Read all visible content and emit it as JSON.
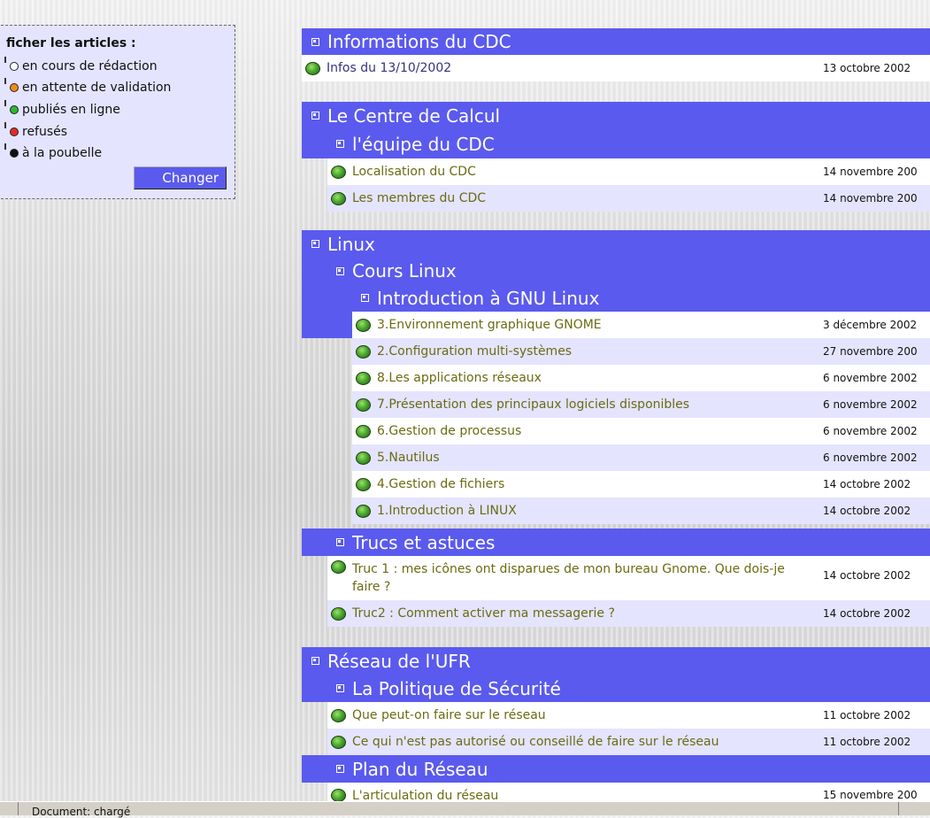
{
  "filter": {
    "title": "ficher les articles :",
    "items": [
      {
        "label": "en cours de rédaction",
        "color": "#ffffff"
      },
      {
        "label": "en attente de validation",
        "color": "#f08a1c"
      },
      {
        "label": "publiés en ligne",
        "color": "#2db82d"
      },
      {
        "label": "refusés",
        "color": "#e22a2a"
      },
      {
        "label": "à la poubelle",
        "color": "#111111"
      }
    ],
    "button": "Changer"
  },
  "sections": {
    "infos": {
      "header": "Informations du CDC",
      "articles": [
        {
          "title": "Infos du 13/10/2002",
          "date": "13 octobre 2002"
        }
      ]
    },
    "cdc": {
      "header": "Le Centre de Calcul",
      "sub": {
        "header": "l'équipe du CDC",
        "articles": [
          {
            "title": "Localisation du CDC",
            "date": "14 novembre 200"
          },
          {
            "title": "Les membres du CDC",
            "date": "14 novembre 200"
          }
        ]
      }
    },
    "linux": {
      "header": "Linux",
      "sub": {
        "header": "Cours Linux",
        "subsub": {
          "header": "Introduction à GNU Linux",
          "articles": [
            {
              "title": "3.Environnement graphique GNOME",
              "date": "3 décembre 2002"
            },
            {
              "title": "2.Configuration multi-systèmes",
              "date": "27 novembre 200"
            },
            {
              "title": "8.Les applications réseaux",
              "date": "6 novembre 2002"
            },
            {
              "title": "7.Présentation des principaux logiciels disponibles",
              "date": "6 novembre 2002"
            },
            {
              "title": "6.Gestion de processus",
              "date": "6 novembre 2002"
            },
            {
              "title": "5.Nautilus",
              "date": "6 novembre 2002"
            },
            {
              "title": "4.Gestion de fichiers",
              "date": "14 octobre 2002"
            },
            {
              "title": "1.Introduction à LINUX",
              "date": "14 octobre 2002"
            }
          ]
        }
      },
      "sub2": {
        "header": "Trucs et astuces",
        "articles": [
          {
            "title": "Truc 1 : mes icônes ont disparues de mon bureau Gnome. Que dois-je faire ?",
            "date": "14 octobre 2002"
          },
          {
            "title": "Truc2 : Comment activer ma messagerie ?",
            "date": "14 octobre 2002"
          }
        ]
      }
    },
    "reseau": {
      "header": "Réseau de l'UFR",
      "sub": {
        "header": "La Politique de Sécurité",
        "articles": [
          {
            "title": "Que peut-on faire sur le réseau",
            "date": "11 octobre 2002"
          },
          {
            "title": "Ce qui n'est pas autorisé ou conseillé de faire sur le réseau",
            "date": "11 octobre 2002"
          }
        ]
      },
      "sub2": {
        "header": "Plan du Réseau",
        "articles": [
          {
            "title": "L'articulation du réseau",
            "date": "15 novembre 200"
          }
        ]
      }
    }
  },
  "status": {
    "text": "Document: chargé"
  }
}
